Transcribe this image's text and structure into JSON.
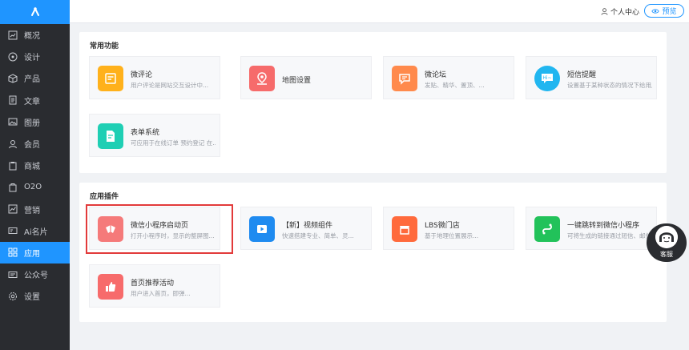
{
  "sidebar": {
    "items": [
      {
        "label": "概况",
        "icon": "chart-icon"
      },
      {
        "label": "设计",
        "icon": "palette-icon"
      },
      {
        "label": "产品",
        "icon": "box-icon"
      },
      {
        "label": "文章",
        "icon": "document-icon"
      },
      {
        "label": "图册",
        "icon": "image-icon"
      },
      {
        "label": "会员",
        "icon": "user-icon"
      },
      {
        "label": "商城",
        "icon": "clipboard-icon"
      },
      {
        "label": "O2O",
        "icon": "store-icon"
      },
      {
        "label": "营销",
        "icon": "trend-icon"
      },
      {
        "label": "Ai名片",
        "icon": "card-icon"
      },
      {
        "label": "应用",
        "icon": "grid-icon",
        "active": true
      },
      {
        "label": "公众号",
        "icon": "id-icon"
      },
      {
        "label": "设置",
        "icon": "gear-icon"
      }
    ]
  },
  "topbar": {
    "user_center": "个人中心",
    "preview": "预览"
  },
  "common": {
    "title": "常用功能",
    "cards": [
      {
        "title": "微评论",
        "desc": "用户评论是网站交互设计中...",
        "color": "#ffb11b",
        "icon": "comment-icon"
      },
      {
        "title": "地图设置",
        "desc": "",
        "color": "#f66b6b",
        "icon": "map-pin-icon"
      },
      {
        "title": "微论坛",
        "desc": "发贴、精华、置顶、...",
        "color": "#ff8a4c",
        "icon": "forum-icon"
      },
      {
        "title": "短信提醒",
        "desc": "设置基于某种状态的情况下给用户",
        "color": "#21b6f0",
        "icon": "sms-icon"
      },
      {
        "title": "表单系统",
        "desc": "可应用于在线订单 预约登记 在...",
        "color": "#1fcfb4",
        "icon": "form-icon"
      }
    ]
  },
  "plugins": {
    "title": "应用插件",
    "cards": [
      {
        "title": "微信小程序启动页",
        "desc": "打开小程序时，显示的整屏图...",
        "color": "#f57a7a",
        "icon": "miniapp-launch-icon"
      },
      {
        "title": "【新】视频组件",
        "desc": "快速搭建专业、简单、灵...",
        "color": "#1f8bf0",
        "icon": "video-icon"
      },
      {
        "title": "LBS微门店",
        "desc": "基于地理位置展示...",
        "color": "#ff6a3c",
        "icon": "shop-icon"
      },
      {
        "title": "一键跳转到微信小程序",
        "desc": "可将生成的链接通过短信、邮件",
        "color": "#22c25a",
        "icon": "miniapp-jump-icon"
      },
      {
        "title": "首页推荐活动",
        "desc": "用户进入首页，即弹...",
        "color": "#f76b6b",
        "icon": "thumbs-up-icon"
      }
    ]
  },
  "service": {
    "label": "客服"
  }
}
